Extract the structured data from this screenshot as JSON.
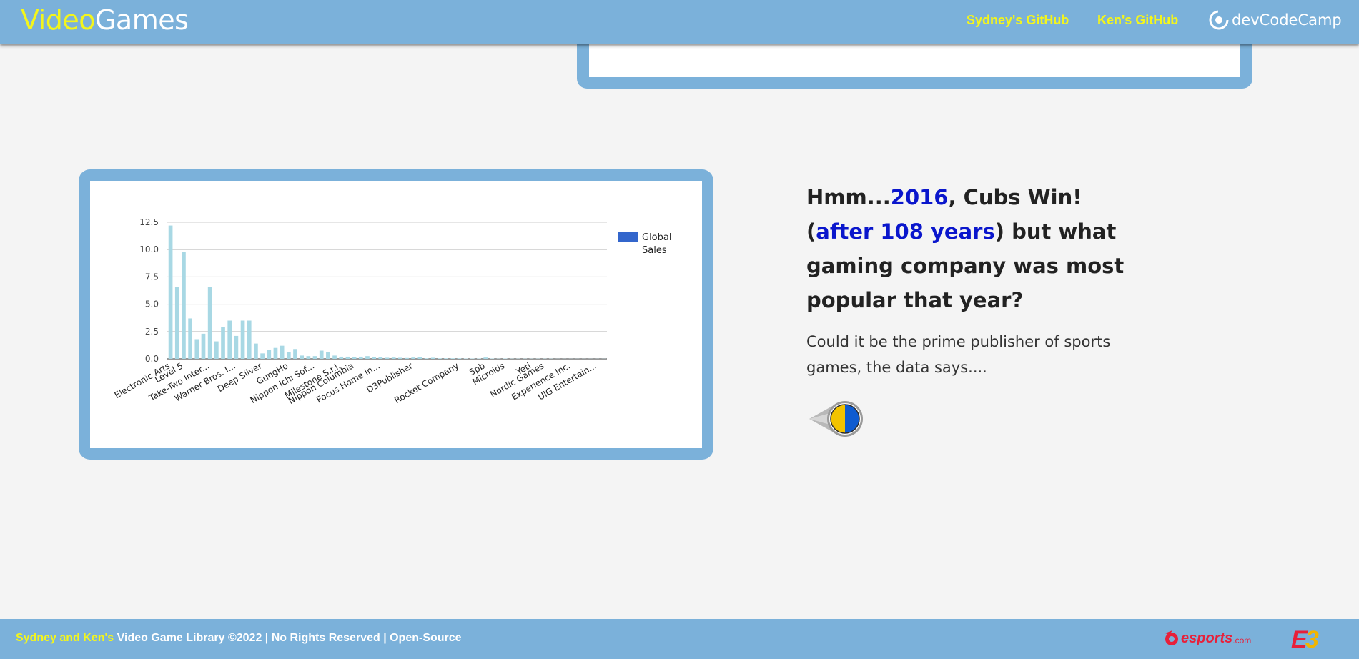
{
  "header": {
    "brand_part1": "Video",
    "brand_part2": "Games",
    "links": [
      "Sydney's GitHub",
      "Ken's GitHub"
    ],
    "partner_logo_text": "devCodeCamp"
  },
  "section": {
    "headline_1": "Hmm...",
    "headline_year": "2016",
    "headline_2": ", Cubs Win!",
    "headline_paren_open": "(",
    "headline_years": "after 108 years",
    "headline_3": ") but what gaming company was most popular that year?",
    "subtext": "Could it be the prime publisher of sports games, the data says....",
    "reveal_icon": "cubs-pin-icon"
  },
  "chart_data": {
    "type": "bar",
    "title": "",
    "xlabel": "",
    "ylabel": "",
    "ylim": [
      0,
      12.5
    ],
    "yticks": [
      "0.0",
      "2.5",
      "5.0",
      "7.5",
      "10.0",
      "12.5"
    ],
    "legend": {
      "position": "right",
      "entries": [
        "Global Sales"
      ]
    },
    "series_color": "#a8d8e4",
    "legend_color": "#3366cc",
    "grid": true,
    "tick_labels": [
      "Electronic Arts",
      "Level 5",
      "Take-Two Inter...",
      "Warner Bros. I...",
      "Deep Silver",
      "GungHo",
      "Nippon Ichi Sof...",
      "Milestone S.r.l.",
      "Nippon Columbia",
      "Focus Home In...",
      "D3Publisher",
      "Rocket Company",
      "5pb",
      "Microids",
      "Yeti",
      "Nordic Games",
      "Experience Inc.",
      "UIG Entertain..."
    ],
    "tick_label_indices": [
      0,
      2,
      6,
      10,
      14,
      18,
      22,
      26,
      28,
      32,
      37,
      44,
      48,
      51,
      55,
      57,
      61,
      65
    ],
    "values": [
      12.2,
      6.6,
      9.8,
      3.7,
      1.8,
      2.3,
      6.6,
      1.6,
      2.9,
      3.5,
      2.1,
      3.5,
      3.5,
      1.4,
      0.5,
      0.85,
      1.0,
      1.2,
      0.6,
      0.9,
      0.3,
      0.25,
      0.25,
      0.75,
      0.6,
      0.3,
      0.2,
      0.2,
      0.15,
      0.2,
      0.25,
      0.15,
      0.15,
      0.1,
      0.12,
      0.1,
      0.08,
      0.12,
      0.15,
      0.05,
      0.1,
      0.05,
      0.05,
      0.05,
      0.05,
      0.03,
      0.03,
      0.03,
      0.12,
      0.03,
      0.02,
      0.03,
      0.02,
      0.02,
      0.02,
      0.02,
      0.02,
      0.02,
      0.02,
      0.01,
      0.01,
      0.01,
      0.01,
      0.01,
      0.01,
      0.01,
      0.01
    ]
  },
  "footer": {
    "names": "Sydney and Ken's",
    "text": " Video Game Library ©2022 | No Rights Reserved | Open-Source",
    "logo1_main": "esports",
    "logo1_suffix": ".com",
    "logo2": "E3"
  }
}
